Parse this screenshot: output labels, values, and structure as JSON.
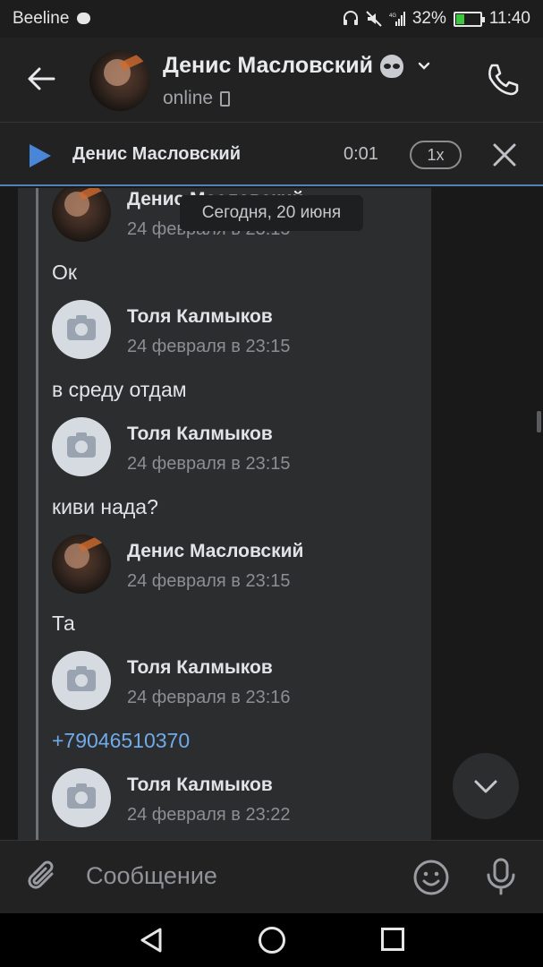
{
  "status_bar": {
    "carrier": "Beeline",
    "network": "4G",
    "battery": "32%",
    "time": "11:40",
    "icons": [
      "message-icon",
      "headphones-icon",
      "mute-icon",
      "signal-icon",
      "battery-icon"
    ]
  },
  "header": {
    "contact_name": "Денис Масловский",
    "status": "online",
    "icons": [
      "back-arrow-icon",
      "alien-emoji-icon",
      "chevron-down-icon",
      "mobile-phone-icon",
      "call-icon"
    ]
  },
  "player": {
    "track": "Денис Масловский",
    "time": "0:01",
    "speed": "1x"
  },
  "date_pill": "Сегодня, 20 июня",
  "messages": [
    {
      "author": "Денис Масловский",
      "date": "24 февраля в 23:15",
      "text": "Ок",
      "avatar": "photo"
    },
    {
      "author": "Толя Калмыков",
      "date": "24 февраля в 23:15",
      "text": "в среду отдам",
      "avatar": "camera"
    },
    {
      "author": "Толя Калмыков",
      "date": "24 февраля в 23:15",
      "text": "киви нада?",
      "avatar": "camera"
    },
    {
      "author": "Денис Масловский",
      "date": "24 февраля в 23:15",
      "text": "Та",
      "avatar": "photo"
    },
    {
      "author": "Толя Калмыков",
      "date": "24 февраля в 23:16",
      "text": "+79046510370",
      "avatar": "camera",
      "is_link": true
    },
    {
      "author": "Толя Калмыков",
      "date": "24 февраля в 23:22",
      "text": "",
      "avatar": "camera"
    }
  ],
  "composer": {
    "placeholder": "Сообщение"
  },
  "colors": {
    "background": "#19191a",
    "bubble": "#2c2d2e",
    "accent": "#5181b8",
    "link": "#71aaeb"
  }
}
